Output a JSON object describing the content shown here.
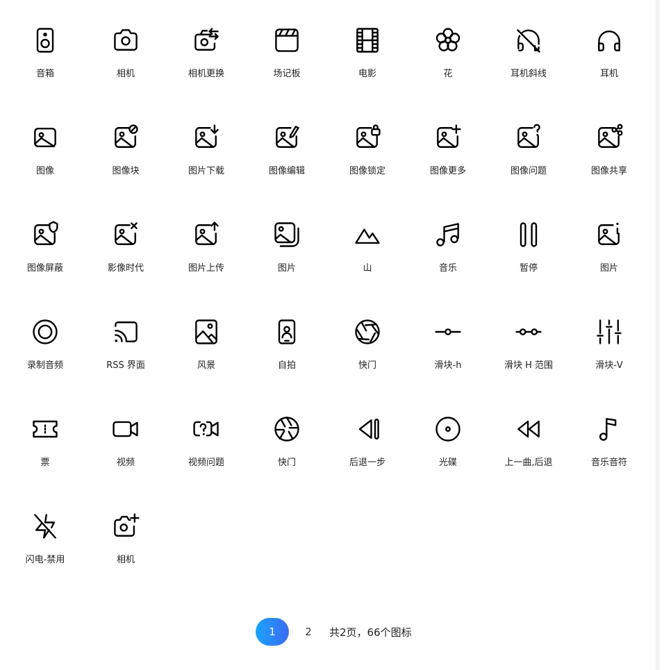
{
  "icons": [
    {
      "name": "speaker-icon",
      "label": "音箱"
    },
    {
      "name": "camera-icon",
      "label": "相机"
    },
    {
      "name": "camera-switch-icon",
      "label": "相机更换"
    },
    {
      "name": "clapperboard-icon",
      "label": "场记板"
    },
    {
      "name": "film-icon",
      "label": "电影"
    },
    {
      "name": "flower-icon",
      "label": "花"
    },
    {
      "name": "headphones-off-icon",
      "label": "耳机斜线"
    },
    {
      "name": "headphones-icon",
      "label": "耳机"
    },
    {
      "name": "image-icon",
      "label": "图像"
    },
    {
      "name": "image-block-icon",
      "label": "图像块"
    },
    {
      "name": "image-download-icon",
      "label": "图片下载"
    },
    {
      "name": "image-edit-icon",
      "label": "图像编辑"
    },
    {
      "name": "image-lock-icon",
      "label": "图像锁定"
    },
    {
      "name": "image-plus-icon",
      "label": "图像更多"
    },
    {
      "name": "image-question-icon",
      "label": "图像问题"
    },
    {
      "name": "image-share-icon",
      "label": "图像共享"
    },
    {
      "name": "image-shield-icon",
      "label": "图像屏蔽"
    },
    {
      "name": "image-x-icon",
      "label": "影像时代"
    },
    {
      "name": "image-upload-icon",
      "label": "图片上传"
    },
    {
      "name": "images-icon",
      "label": "图片"
    },
    {
      "name": "mountain-icon",
      "label": "山"
    },
    {
      "name": "music-icon",
      "label": "音乐"
    },
    {
      "name": "pause-icon",
      "label": "暂停"
    },
    {
      "name": "image-info-icon",
      "label": "图片"
    },
    {
      "name": "record-icon",
      "label": "录制音频"
    },
    {
      "name": "cast-icon",
      "label": "RSS 界面"
    },
    {
      "name": "landscape-icon",
      "label": "风景"
    },
    {
      "name": "selfie-icon",
      "label": "自拍"
    },
    {
      "name": "shutter-icon",
      "label": "快门"
    },
    {
      "name": "slider-h-icon",
      "label": "滑块-h"
    },
    {
      "name": "slider-range-icon",
      "label": "滑块 H 范围"
    },
    {
      "name": "slider-v-icon",
      "label": "滑块-V"
    },
    {
      "name": "ticket-icon",
      "label": "票"
    },
    {
      "name": "video-icon",
      "label": "视频"
    },
    {
      "name": "video-question-icon",
      "label": "视频问题"
    },
    {
      "name": "aperture-icon",
      "label": "快门"
    },
    {
      "name": "step-back-icon",
      "label": "后退一步"
    },
    {
      "name": "disc-icon",
      "label": "光碟"
    },
    {
      "name": "rewind-icon",
      "label": "上一曲,后退"
    },
    {
      "name": "music-note-icon",
      "label": "音乐音符"
    },
    {
      "name": "zap-off-icon",
      "label": "闪电-禁用"
    },
    {
      "name": "camera-plus-icon",
      "label": "相机"
    }
  ],
  "pagination": {
    "pages": [
      "1",
      "2"
    ],
    "current": "1",
    "summary": "共2页，66个图标"
  }
}
